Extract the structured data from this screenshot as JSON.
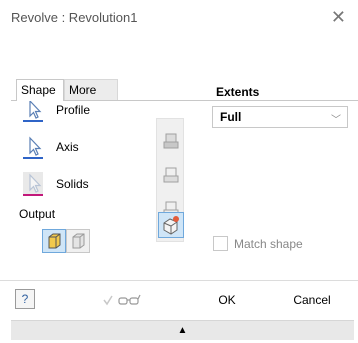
{
  "dialog": {
    "title": "Revolve : Revolution1",
    "close_glyph": "✕"
  },
  "tabs": [
    {
      "label": "Shape",
      "active": true
    },
    {
      "label": "More",
      "active": false
    }
  ],
  "selectors": [
    {
      "label": "Profile",
      "icon": "profile-select-icon",
      "underline_color": "#2f64c7"
    },
    {
      "label": "Axis",
      "icon": "axis-select-icon",
      "underline_color": "#2f64c7"
    },
    {
      "label": "Solids",
      "icon": "solids-select-icon",
      "underline_color": "#c2187a"
    }
  ],
  "output": {
    "label": "Output",
    "buttons": [
      {
        "icon": "solid-output-icon",
        "active": true
      },
      {
        "icon": "surface-output-icon",
        "active": false
      }
    ]
  },
  "operations": [
    {
      "icon": "join-icon",
      "enabled": false
    },
    {
      "icon": "cut-icon",
      "enabled": false
    },
    {
      "icon": "intersect-icon",
      "enabled": false
    },
    {
      "icon": "new-solid-icon",
      "enabled": true
    }
  ],
  "extents": {
    "label": "Extents",
    "value": "Full"
  },
  "match_shape": {
    "label": "Match shape",
    "checked": false
  },
  "footer": {
    "help_glyph": "?",
    "preview_icon": "preview-glasses-icon",
    "ok_label": "OK",
    "cancel_label": "Cancel"
  },
  "expander_glyph": "▲",
  "colors": {
    "accent": "#6fa8dc",
    "active_fill": "#cfe5f7",
    "solid_fill": "#f2c94c"
  }
}
